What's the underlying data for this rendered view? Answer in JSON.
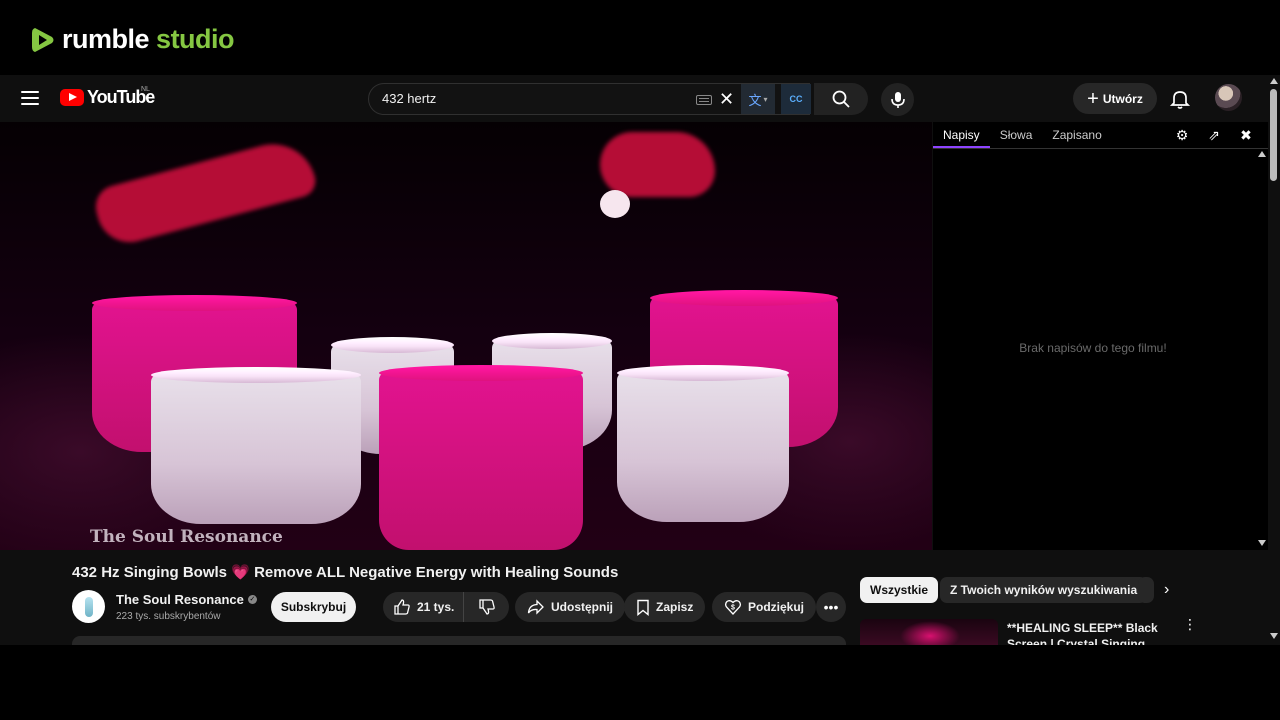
{
  "rumble": {
    "brand_word1": "rumble",
    "brand_word2": "studio",
    "brand_color": "#85c742"
  },
  "youtube": {
    "logo_text": "YouTube",
    "country_code": "NL",
    "search_value": "432 hertz",
    "create_label": "Utwórz"
  },
  "transcript_panel": {
    "tabs": [
      "Napisy",
      "Słowa",
      "Zapisano"
    ],
    "active_tab": "Napisy",
    "empty_message": "Brak napisów do tego filmu!"
  },
  "video": {
    "watermark": "The Soul Resonance",
    "title_part1": "432 Hz Singing Bowls",
    "title_emoji": "💗",
    "title_part2": "Remove ALL Negative Energy with Healing Sounds",
    "channel_name": "The Soul Resonance",
    "subscribers": "223 tys. subskrybentów",
    "subscribe_label": "Subskrybuj",
    "likes": "21 tys.",
    "share_label": "Udostępnij",
    "save_label": "Zapisz",
    "thanks_label": "Podziękuj"
  },
  "chips": {
    "all": "Wszystkie",
    "from_search": "Z Twoich wyników wyszukiwania"
  },
  "related": {
    "title": "**HEALING SLEEP** Black Screen | Crystal Singing Bowls"
  },
  "colors": {
    "accent_tab": "#8e44ff",
    "bowl_pink": "#e2138f",
    "youtube_red": "#ff0000"
  }
}
